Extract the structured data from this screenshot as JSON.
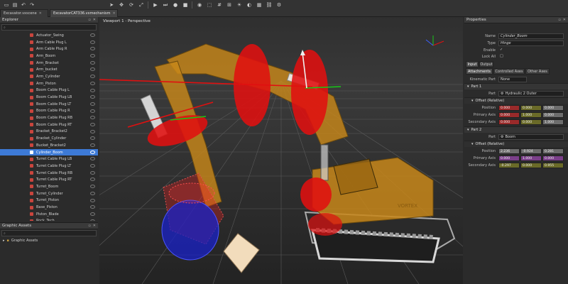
{
  "tabs": [
    {
      "label": "Excavator.vxscene",
      "active": false
    },
    {
      "label": "ExcavatorCAT336.vxmechanism",
      "active": true
    }
  ],
  "explorer": {
    "title": "Explorer",
    "items": [
      "Actuator_Swing",
      "Arm Cable Plug L",
      "Arm Cable Plug R",
      "Arm_Boom",
      "Arm_Bracket",
      "Arm_bucket",
      "Arm_Cylinder",
      "Arm_Piston",
      "Boom Cable Plug L",
      "Boom Cable Plug LB",
      "Boom Cable Plug LT",
      "Boom Cable Plug R",
      "Boom Cable Plug RB",
      "Boom Cable Plug RT",
      "Bracket_Bracket2",
      "Bracket_Cylinder",
      "Bucket_Bracket2",
      "Cylinder_Boom",
      "Turret Cable Plug LB",
      "Turret Cable Plug LT",
      "Turret Cable Plug RB",
      "Turret Cable Plug RT",
      "Turret_Boom",
      "Turret_Cylinder",
      "Turret_Piston",
      "Base_Piston",
      "Piston_Blade",
      "Rock_Tech"
    ],
    "selected_index": 17
  },
  "graphic_assets": {
    "title": "Graphic Assets",
    "items": [
      "Graphic Assets"
    ]
  },
  "viewport": {
    "title": "Viewport 1 - Perspective",
    "label": "VORTEX"
  },
  "properties": {
    "title": "Properties",
    "name_label": "Name",
    "name_value": "Cylinder_Boom",
    "type_label": "Type",
    "type_value": "Hinge",
    "enable_label": "Enable",
    "enable_value": "✓",
    "lockall_label": "Lock All",
    "lockall_value": "□",
    "io_tabs": [
      "Input",
      "Output"
    ],
    "sub_tabs": [
      "Attachments",
      "Controlled Axes",
      "Other Axes"
    ],
    "kin_label": "Kinematic Part",
    "kin_value": "None",
    "part1": {
      "section": "Part 1",
      "part_label": "Part",
      "part_value": "Hydraulic 2 Outer",
      "offset": "Offset (Relative)",
      "position": [
        "0.000",
        "0.000",
        "0.000"
      ],
      "primary": [
        "0.000",
        "1.000",
        "0.000"
      ],
      "secondary": [
        "0.000",
        "0.000",
        "1.000"
      ]
    },
    "part2": {
      "section": "Part 2",
      "part_label": "Part",
      "part_value": "Boom",
      "offset": "Offset (Relative)",
      "position": [
        "2.236",
        "-0.924",
        "0.281"
      ],
      "primary": [
        "0.000",
        "1.000",
        "0.000"
      ],
      "secondary": [
        "-0.297",
        "0.000",
        "0.955"
      ]
    },
    "labels": {
      "position": "Position",
      "primary": "Primary Axis",
      "secondary": "Secondary Axis"
    }
  },
  "colors": {
    "selection": "#3d7ad6",
    "accent_red": "#e01010",
    "excavator": "#c8871a"
  }
}
